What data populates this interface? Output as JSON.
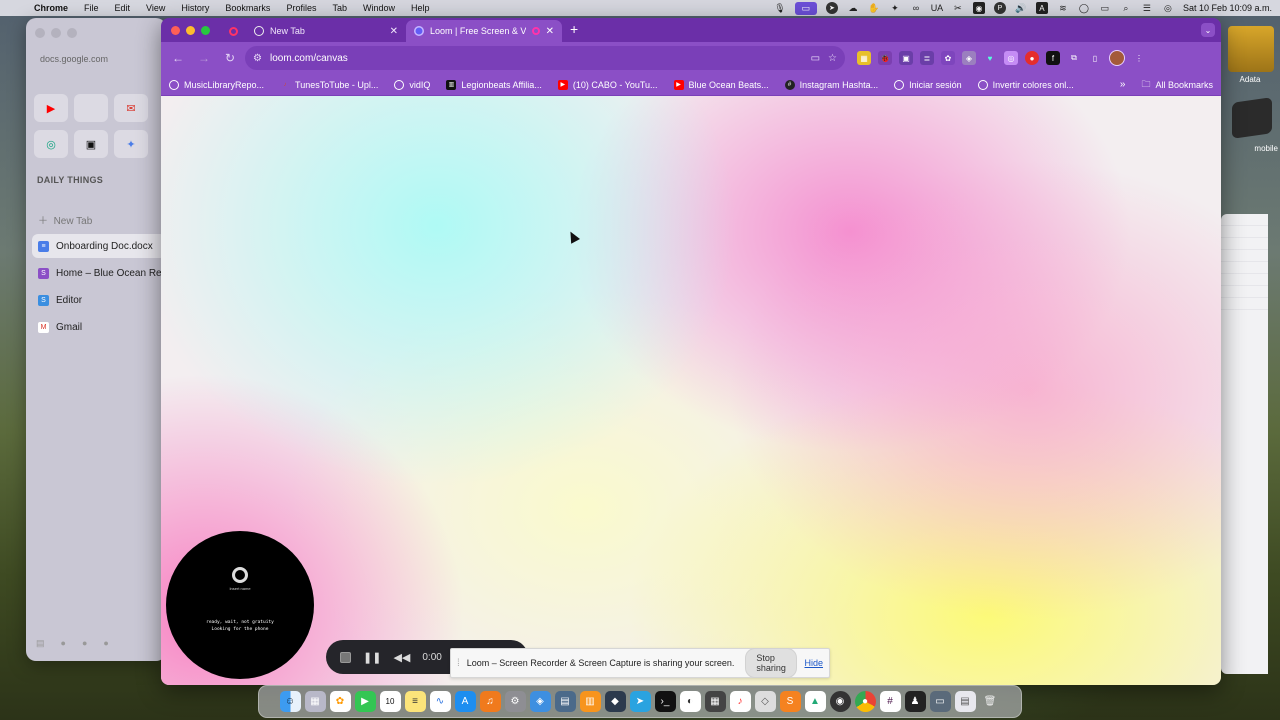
{
  "menubar": {
    "app_name": "Chrome",
    "menus": [
      "File",
      "Edit",
      "View",
      "History",
      "Bookmarks",
      "Profiles",
      "Tab",
      "Window",
      "Help"
    ],
    "input_source": "UA",
    "clock": "Sat 10 Feb  10:09 a.m."
  },
  "bg_window": {
    "url": "docs.google.com",
    "section_title": "DAILY THINGS",
    "new_tab_label": "New Tab",
    "tabs": [
      {
        "label": "Onboarding Doc.docx",
        "icon": "docs-icon",
        "color": "#4a7de8"
      },
      {
        "label": "Home – Blue Ocean Recordings",
        "icon": "site-icon",
        "color": "#8b4fc6"
      },
      {
        "label": "Editor",
        "icon": "editor-icon",
        "color": "#3a8ee0"
      },
      {
        "label": "Gmail",
        "icon": "gmail-icon",
        "color": "#d93025"
      }
    ]
  },
  "desktop": {
    "drive_label": "Adata",
    "hdd_label": "mobile"
  },
  "chrome": {
    "tabs": [
      {
        "title": "New Tab"
      },
      {
        "title": "Loom | Free Screen & Video Recording"
      }
    ],
    "url": "loom.com/canvas",
    "bookmarks": [
      {
        "label": "MusicLibraryRepo...",
        "color": "#ffffff"
      },
      {
        "label": "TunesToTube - Upl...",
        "color": "#c94a3a"
      },
      {
        "label": "vidIQ",
        "color": "#ffffff"
      },
      {
        "label": "Legionbeats Affilia...",
        "color": "#111111"
      },
      {
        "label": "(10) CABO - YouTu...",
        "color": "#ff0000"
      },
      {
        "label": "Blue Ocean Beats...",
        "color": "#ff0000"
      },
      {
        "label": "Instagram Hashta...",
        "color": "#222222"
      },
      {
        "label": "Iniciar sesión",
        "color": "#ffffff"
      },
      {
        "label": "Invertir colores onl...",
        "color": "#ffffff"
      }
    ],
    "all_bookmarks_label": "All Bookmarks",
    "accent_color": "#8b4fc6"
  },
  "loom": {
    "camera_name": "Insert name",
    "camera_message_line1": "ready, wait, not gratuity",
    "camera_message_line2": "Looking for the phone",
    "timer": "0:00",
    "share_message": "Loom – Screen Recorder & Screen Capture is sharing your screen.",
    "stop_sharing_label": "Stop sharing",
    "hide_label": "Hide"
  },
  "dock_apps": [
    "finder",
    "launchpad",
    "photos",
    "facetime",
    "calendar",
    "notes",
    "freeform",
    "app-store",
    "garageband",
    "settings",
    "safari-alt",
    "preview",
    "books",
    "davinci",
    "telegram",
    "terminal",
    "activity",
    "calculator",
    "music",
    "crossover",
    "sublime",
    "inkscape",
    "obs",
    "chrome",
    "slack",
    "person",
    "display",
    "files",
    "trash"
  ]
}
